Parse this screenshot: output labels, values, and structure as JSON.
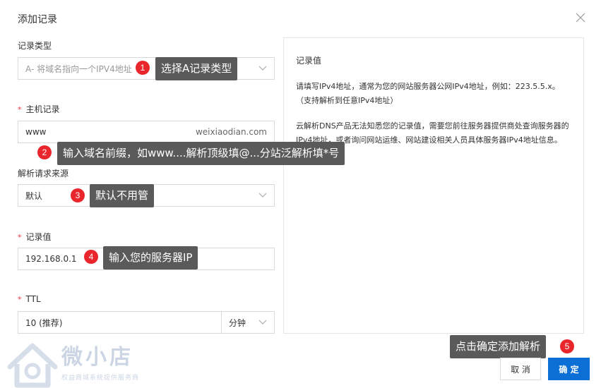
{
  "dialog": {
    "title": "添加记录"
  },
  "form": {
    "record_type": {
      "label": "记录类型",
      "value": "A- 将域名指向一个IPV4地址"
    },
    "host": {
      "label": "主机记录",
      "value": "www",
      "suffix": "weixiaodian.com"
    },
    "line": {
      "label": "解析请求来源",
      "value": "默认"
    },
    "record_value": {
      "label": "记录值",
      "value": "192.168.0.1"
    },
    "ttl": {
      "label": "TTL",
      "value": "10 (推荐)",
      "unit": "分钟"
    },
    "required_mark": "*"
  },
  "info": {
    "title": "记录值",
    "p1": "请填写IPv4地址，通常为您的网站服务器公网IPv4地址，例如：223.5.5.x。（支持解析到任意IPv4地址）",
    "p2": "云解析DNS产品无法知悉您的记录值，需要您前往服务器提供商处查询服务器的IPv4地址，或者询问网站运维、网站建设相关人员具体服务器IPv4地址信息。"
  },
  "annotations": [
    {
      "num": "1",
      "text": "选择A记录类型"
    },
    {
      "num": "2",
      "text": "输入域名前缀，如www....解析顶级填@...分站泛解析填*号"
    },
    {
      "num": "3",
      "text": "默认不用管"
    },
    {
      "num": "4",
      "text": "输入您的服务器IP"
    },
    {
      "num": "5",
      "text": "点击确定添加解析"
    }
  ],
  "buttons": {
    "cancel": "取 消",
    "ok": "确 定"
  },
  "watermark": {
    "name": "微小店",
    "tagline": "权益商城系统提供服务商"
  },
  "icons": [
    "close-icon",
    "chevron-down-icon",
    "logo-house-icon"
  ],
  "colors": {
    "primary": "#0b6fd6",
    "badge": "#e8262c",
    "tooltip": "#5a5a5a",
    "required": "#e4393c"
  }
}
